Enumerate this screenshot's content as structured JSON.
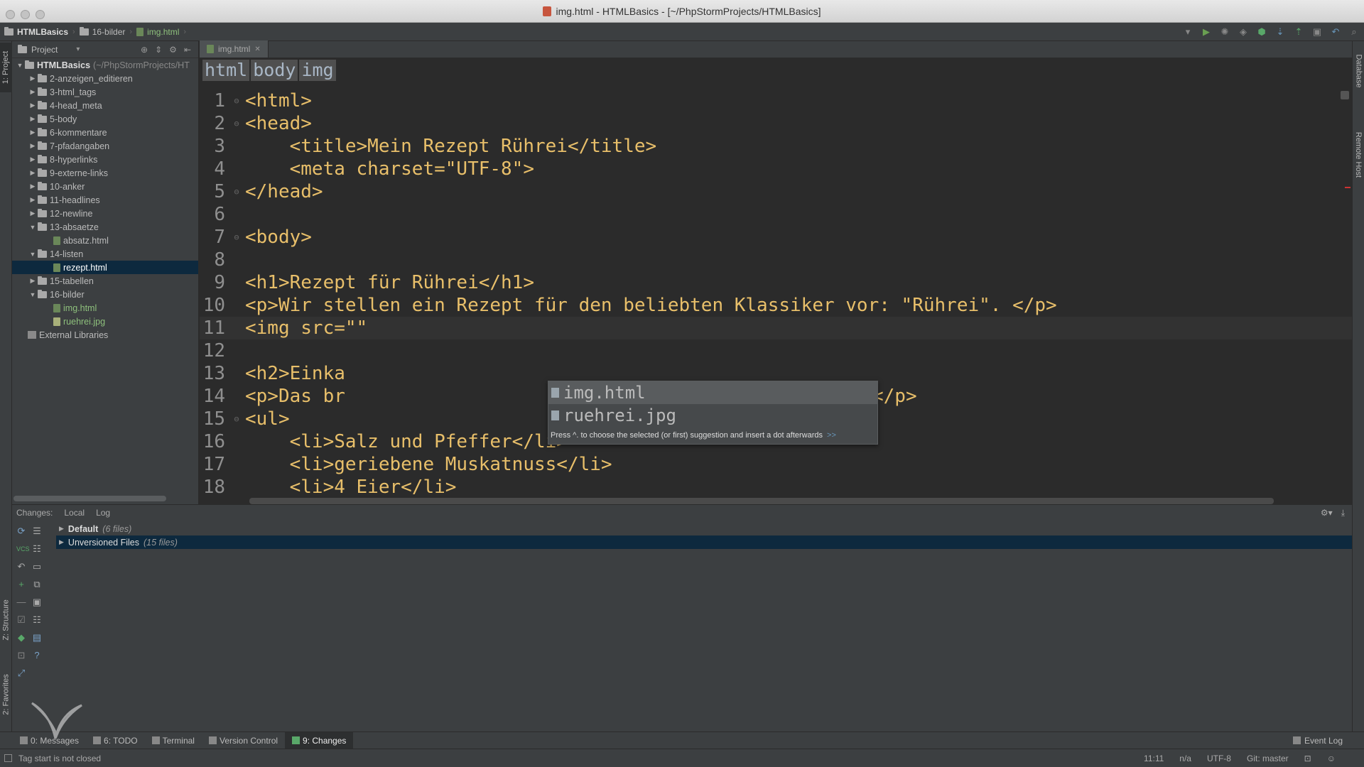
{
  "window": {
    "title": "img.html - HTMLBasics - [~/PhpStormProjects/HTMLBasics]"
  },
  "navbar": {
    "crumbs": [
      "HTMLBasics",
      "16-bilder",
      "img.html"
    ]
  },
  "left_strip": {
    "tab1": "1: Project",
    "tab2": "Z: Structure",
    "tab3": "2: Favorites"
  },
  "right_strip": {
    "tab1": "Database",
    "tab2": "Remote Host"
  },
  "project_panel": {
    "header": "Project",
    "root": {
      "name": "HTMLBasics",
      "path": "(~/PhpStormProjects/HT"
    },
    "items": [
      {
        "label": "2-anzeigen_editieren"
      },
      {
        "label": "3-html_tags"
      },
      {
        "label": "4-head_meta"
      },
      {
        "label": "5-body"
      },
      {
        "label": "6-kommentare"
      },
      {
        "label": "7-pfadangaben"
      },
      {
        "label": "8-hyperlinks"
      },
      {
        "label": "9-externe-links"
      },
      {
        "label": "10-anker"
      },
      {
        "label": "11-headlines"
      },
      {
        "label": "12-newline"
      },
      {
        "label": "13-absaetze"
      },
      {
        "label": "absatz.html"
      },
      {
        "label": "14-listen"
      },
      {
        "label": "rezept.html"
      },
      {
        "label": "15-tabellen"
      },
      {
        "label": "16-bilder"
      },
      {
        "label": "img.html"
      },
      {
        "label": "ruehrei.jpg"
      },
      {
        "label": "External Libraries"
      }
    ]
  },
  "editor": {
    "tab": "img.html",
    "breadcrumbs": [
      "html",
      "body",
      "img"
    ],
    "lines": [
      {
        "n": "1",
        "text": "<html>"
      },
      {
        "n": "2",
        "text": "<head>"
      },
      {
        "n": "3",
        "text": "    <title>Mein Rezept Rührei</title>"
      },
      {
        "n": "4",
        "text": "    <meta charset=\"UTF-8\">"
      },
      {
        "n": "5",
        "text": "</head>"
      },
      {
        "n": "6",
        "text": ""
      },
      {
        "n": "7",
        "text": "<body>"
      },
      {
        "n": "8",
        "text": ""
      },
      {
        "n": "9",
        "text": "<h1>Rezept für Rührei</h1>"
      },
      {
        "n": "10",
        "text": "<p>Wir stellen ein Rezept für den beliebten Klassiker vor: \"Rührei\". </p>"
      },
      {
        "n": "11",
        "text": "<img src=\"\""
      },
      {
        "n": "12",
        "text": ""
      },
      {
        "n": "13",
        "text": "<h2>Einka"
      },
      {
        "n": "14",
        "text": "<p>Das br"
      },
      {
        "n": "15",
        "text": "<ul>"
      },
      {
        "n": "16",
        "text": "    <li>Salz und Pfeffer</li>"
      },
      {
        "n": "17",
        "text": "    <li>geriebene Muskatnuss</li>"
      },
      {
        "n": "18",
        "text": "    <li>4 Eier</li>"
      }
    ],
    "line14_tail": "</p>"
  },
  "autocomplete": {
    "items": [
      "img.html",
      "ruehrei.jpg"
    ],
    "hint": "Press ^. to choose the selected (or first) suggestion and insert a dot afterwards",
    "more": ">>"
  },
  "changes_panel": {
    "tabs": [
      "Changes:",
      "Local",
      "Log"
    ],
    "rows": [
      {
        "label": "Default",
        "count": "(6 files)"
      },
      {
        "label": "Unversioned Files",
        "count": "(15 files)"
      }
    ]
  },
  "tool_windows": [
    "0: Messages",
    "6: TODO",
    "Terminal",
    "Version Control",
    "9: Changes"
  ],
  "event_log": "Event Log",
  "status": {
    "message": "Tag start is not closed",
    "position": "11:11",
    "na": "n/a",
    "encoding": "UTF-8",
    "git": "Git: master"
  }
}
